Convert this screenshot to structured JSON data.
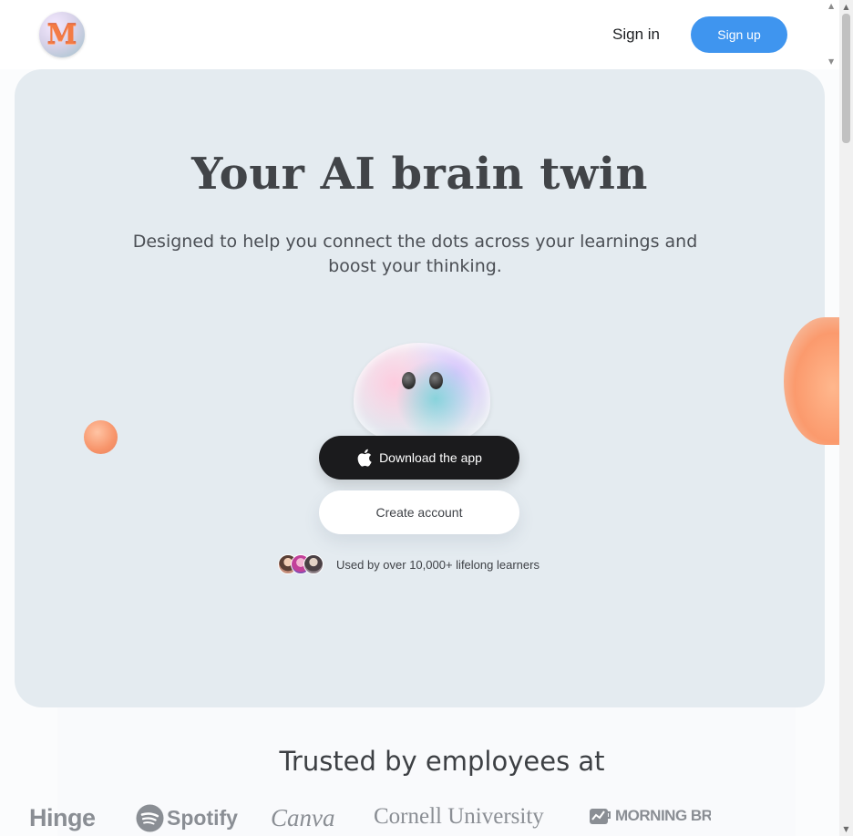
{
  "header": {
    "logo_text": "M",
    "signin_label": "Sign in",
    "signup_label": "Sign up"
  },
  "hero": {
    "title": "Your AI brain twin",
    "subtitle": "Designed to help you connect the dots across your learnings and boost your thinking.",
    "download_label": "Download the app",
    "create_label": "Create account",
    "social_proof": "Used by over 10,000+ lifelong learners"
  },
  "trusted": {
    "title": "Trusted by employees at",
    "brands": [
      "Hinge",
      "Spotify",
      "Canva",
      "Cornell University",
      "MORNING BR"
    ]
  },
  "icons": {
    "download": "apple-icon",
    "spotify": "spotify-icon",
    "morning_brew": "morning-brew-icon"
  },
  "colors": {
    "accent": "#3f95ef",
    "dark_button": "#1b1b1d",
    "hero_bg": "#e4ebf0",
    "blob": "#fb9a6d"
  }
}
